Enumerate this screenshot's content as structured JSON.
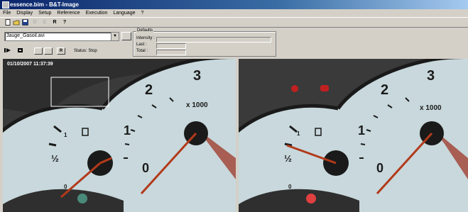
{
  "window": {
    "title": "essence.bim - B&T-Image"
  },
  "menu": [
    {
      "label": "File"
    },
    {
      "label": "Display"
    },
    {
      "label": "Setup"
    },
    {
      "label": "Reference"
    },
    {
      "label": "Execution"
    },
    {
      "label": "Language"
    },
    {
      "label": "?"
    }
  ],
  "toolbar": {
    "d_label": "D",
    "c_label": "C",
    "r_label": "R",
    "help_label": "?"
  },
  "source_select": {
    "value": "Jauge_Gasoil.avi"
  },
  "defaults": {
    "legend": "Defaults",
    "intensity_label": "Intensity :",
    "last_label": "Last :",
    "total_label": "Total :"
  },
  "playback": {
    "r_label": "R"
  },
  "status": {
    "text": "Status: Stop"
  },
  "left_view": {
    "timestamp": "01/10/2007 11:37:39"
  },
  "gauge": {
    "mult": "x 1000",
    "n3": "3",
    "n2": "2",
    "n1": "1",
    "half": "½",
    "n0": "0",
    "small1": "1",
    "small0": "0"
  },
  "colors": {
    "title_start": "#0a246a",
    "title_end": "#a6caf0",
    "needle": "#b23a1a",
    "dial": "#c8d8dc",
    "warning_red": "#e04040"
  }
}
